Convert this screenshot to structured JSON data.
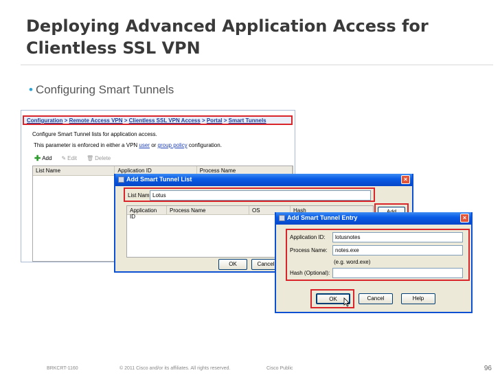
{
  "slide": {
    "title_line1": "Deploying Advanced Application Access for",
    "title_line2": "Clientless SSL VPN",
    "bullet": "Configuring Smart Tunnels"
  },
  "asdm": {
    "breadcrumb": [
      "Configuration",
      " > ",
      "Remote Access VPN",
      " > ",
      "Clientless SSL VPN Access",
      " > ",
      "Portal",
      " > ",
      "Smart Tunnels"
    ],
    "line1": "Configure Smart Tunnel lists for application access.",
    "line2_pre": "This parameter is enforced in either a VPN ",
    "line2_link1": "user",
    "line2_mid": " or ",
    "line2_link2": "group policy",
    "line2_post": " configuration.",
    "toolbar": {
      "add": "Add",
      "edit": "Edit",
      "delete": "Delete"
    },
    "columns": [
      "List Name",
      "Application ID",
      "Process Name"
    ]
  },
  "list_dialog": {
    "title": "Add Smart Tunnel List",
    "list_name_label": "List Name:",
    "list_name_value": "Lotus",
    "columns": [
      "Application ID",
      "Process Name",
      "OS",
      "Hash"
    ],
    "add_btn": "Add",
    "ok": "OK",
    "cancel": "Cancel"
  },
  "entry_dialog": {
    "title": "Add Smart Tunnel Entry",
    "app_id_label": "Application ID:",
    "app_id_value": "lotusnotes",
    "process_label": "Process Name:",
    "process_value": "notes.exe",
    "process_hint": "(e.g. word.exe)",
    "hash_label": "Hash (Optional):",
    "hash_value": "",
    "ok": "OK",
    "cancel": "Cancel",
    "help": "Help"
  },
  "footer": {
    "code": "BRKCRT-1160",
    "copyright": "© 2011 Cisco and/or its affiliates. All rights reserved.",
    "classification": "Cisco Public",
    "page": "96"
  },
  "colors": {
    "highlight": "#d9252a",
    "title_bar": "#0a5ce6",
    "bullet_dot": "#2ca5d6"
  }
}
